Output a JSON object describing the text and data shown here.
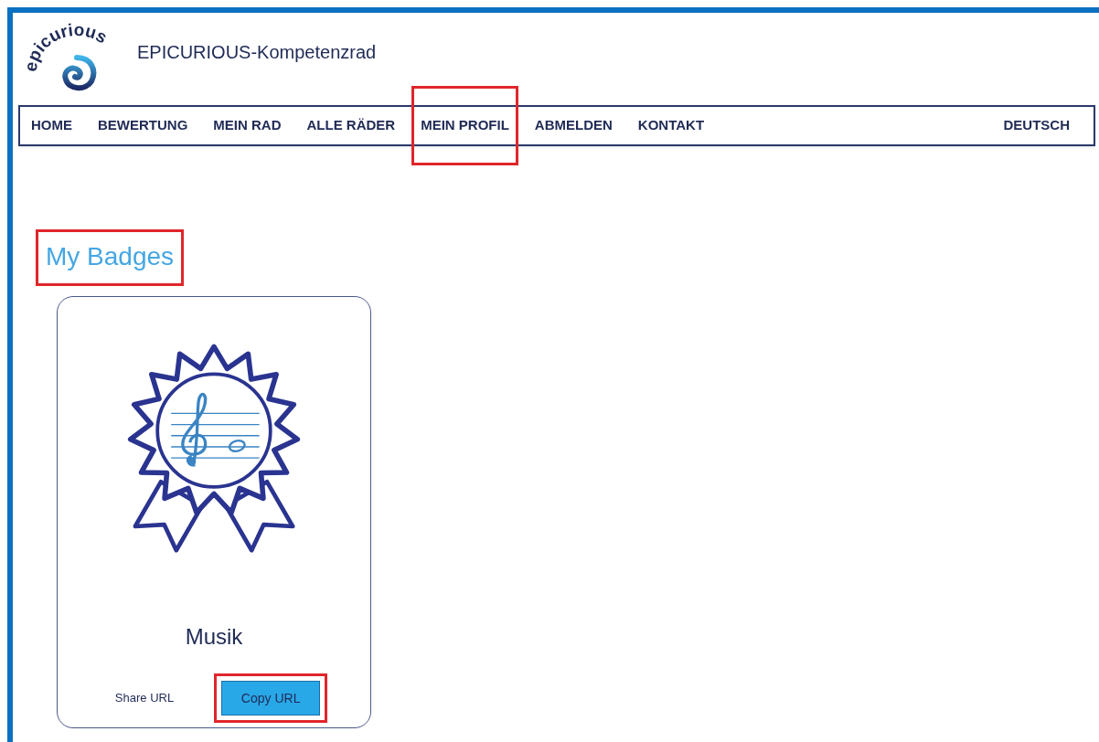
{
  "logo": {
    "text": "epicurious"
  },
  "site_title": "EPICURIOUS-Kompetenzrad",
  "nav": [
    {
      "label": "HOME",
      "highlighted": false
    },
    {
      "label": "BEWERTUNG",
      "highlighted": false
    },
    {
      "label": "MEIN RAD",
      "highlighted": false
    },
    {
      "label": "ALLE RÄDER",
      "highlighted": false
    },
    {
      "label": "MEIN PROFIL",
      "highlighted": true
    },
    {
      "label": "ABMELDEN",
      "highlighted": false
    },
    {
      "label": "KONTAKT",
      "highlighted": false
    }
  ],
  "language": "DEUTSCH",
  "heading": {
    "text": "My Badges",
    "highlighted": true
  },
  "badges": [
    {
      "name": "Musik",
      "share_label": "Share URL",
      "button": {
        "label": "Copy URL",
        "highlighted": true
      }
    }
  ]
}
